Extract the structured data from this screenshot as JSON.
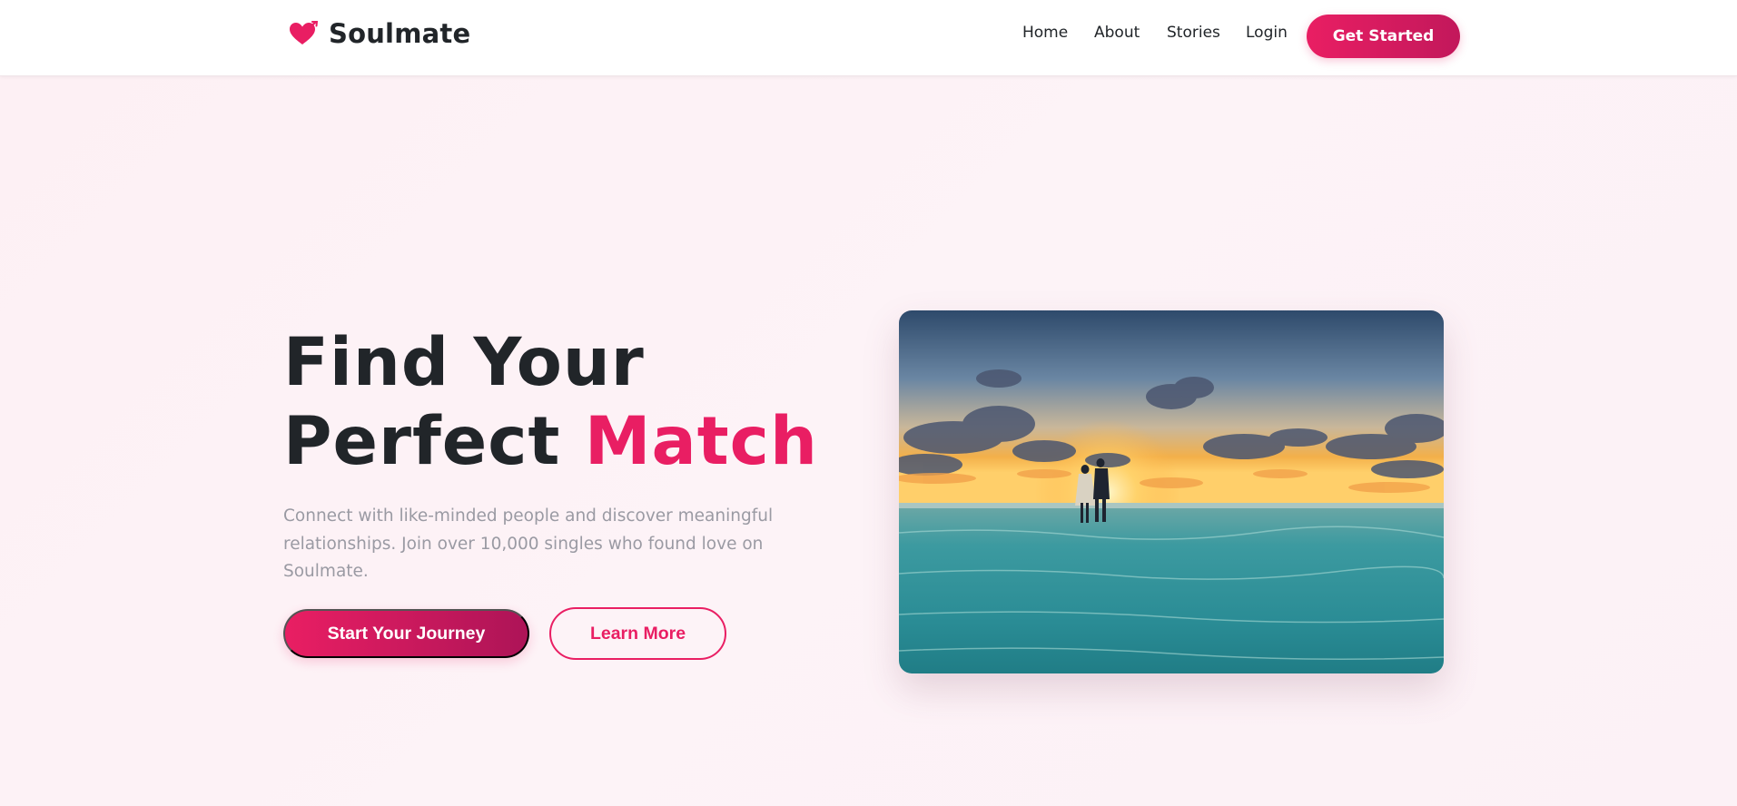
{
  "brand": {
    "name": "Soulmate",
    "icon": "heart-arrow-icon",
    "accent_color": "#e91e63"
  },
  "nav": {
    "items": [
      {
        "label": "Home"
      },
      {
        "label": "About"
      },
      {
        "label": "Stories"
      },
      {
        "label": "Login"
      }
    ],
    "cta_label": "Get Started"
  },
  "hero": {
    "title_line1": "Find Your",
    "title_line2_plain": "Perfect ",
    "title_line2_accent": "Match",
    "subtitle": "Connect with like-minded people and discover meaningful relationships. Join over 10,000 singles who found love on Soulmate.",
    "primary_button": "Start Your Journey",
    "secondary_button": "Learn More",
    "image_alt": "couple walking on beach at sunset"
  }
}
